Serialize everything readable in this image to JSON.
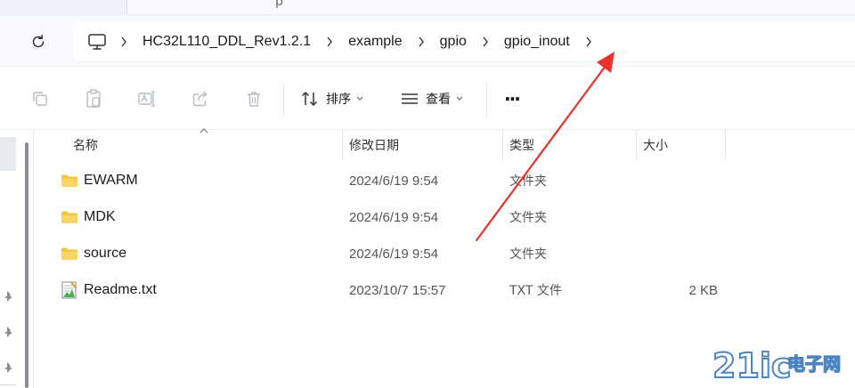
{
  "window": {
    "tab_glyph": "p"
  },
  "breadcrumb": {
    "items": [
      "HC32L110_DDL_Rev1.2.1",
      "example",
      "gpio",
      "gpio_inout"
    ]
  },
  "toolbar": {
    "icons": [
      "copy-icon",
      "paste-icon",
      "rename-icon",
      "share-icon",
      "delete-icon"
    ],
    "sort_label": "排序",
    "view_label": "查看",
    "more_label": "···"
  },
  "columns": {
    "name": "名称",
    "modified": "修改日期",
    "type": "类型",
    "size": "大小"
  },
  "files": [
    {
      "name": "EWARM",
      "modified": "2024/6/19 9:54",
      "type": "文件夹",
      "size": "",
      "icon": "folder-icon"
    },
    {
      "name": "MDK",
      "modified": "2024/6/19 9:54",
      "type": "文件夹",
      "size": "",
      "icon": "folder-icon"
    },
    {
      "name": "source",
      "modified": "2024/6/19 9:54",
      "type": "文件夹",
      "size": "",
      "icon": "folder-icon"
    },
    {
      "name": "Readme.txt",
      "modified": "2023/10/7 15:57",
      "type": "TXT 文件",
      "size": "2 KB",
      "icon": "text-file-icon"
    }
  ],
  "annotation": {
    "color": "#e8322b"
  },
  "watermark": {
    "text_a": "21ic",
    "text_b": "电子网"
  },
  "colors": {
    "folder": "#f4c542",
    "accent": "#0067c0"
  }
}
